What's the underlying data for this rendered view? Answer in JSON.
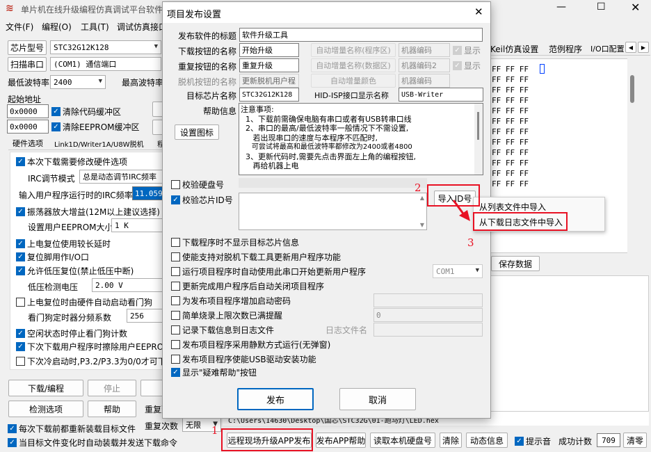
{
  "main": {
    "title": "单片机在线升级编程仿真调试平台软件",
    "menu": [
      "文件(F)",
      "编程(O)",
      "工具(T)",
      "调试仿真接口"
    ],
    "chip_label": "芯片型号",
    "chip_value": "STC32G12K128",
    "scan_label": "扫描串口",
    "port_value": "(COM1) 通信端口",
    "min_baud_label": "最低波特率",
    "min_baud_value": "2400",
    "max_baud_label": "最高波特率",
    "start_addr_label": "起始地址",
    "addr1": "0x0000",
    "clear_code": "清除代码缓冲区",
    "addr2": "0x0000",
    "clear_eeprom": "清除EEPROM缓冲区",
    "tabs": [
      "硬件选项",
      "Link1D/Writer1A/U8W脱机",
      "程"
    ],
    "opt_modify": "本次下载需要修改硬件选项",
    "irc_mode_label": "IRC调节模式",
    "irc_mode_value": "总是动态调节IRC频率",
    "irc_freq_label": "输入用户程序运行时的IRC频率",
    "irc_freq_value": "11.0592",
    "opt_osc": "振荡器放大增益(12M以上建议选择)",
    "eeprom_label": "设置用户EEPROM大小",
    "eeprom_value": "1  K",
    "opt_reset_delay": "上电复位使用较长延时",
    "opt_reset_io": "复位脚用作I/O口",
    "opt_lvr": "允许低压复位(禁止低压中断)",
    "lvd_label": "低压检测电压",
    "lvd_value": "2.00 V",
    "opt_wdt": "上电复位时由硬件自动启动看门狗",
    "wdt_label": "看门狗定时器分频系数",
    "wdt_value": "256",
    "opt_idle_wdt": "空闲状态时停止看门狗计数",
    "opt_erase": "下次下载用户程序时擦除用户EEPROM",
    "opt_p32": "下次冷启动时,P3.2/P3.3为0/0才可下",
    "btn_download": "下载/编程",
    "btn_stop": "停止",
    "btn_check": "检测选项",
    "btn_help": "帮助",
    "repeat_delay": "重复延",
    "repeat_count_label": "重复次数",
    "repeat_count_value": "无限",
    "opt_reload": "每次下载前都重新装载目标文件",
    "opt_autosend": "当目标文件变化时自动装载并发送下载命令",
    "right_tabs": [
      "Keil仿真设置",
      "范例程序",
      "I/O口配置"
    ],
    "hex_rows": [
      "FF FF FF",
      "FF FF FF",
      "FF FF FF",
      "FF FF FF",
      "FF FF FF",
      "FF FF FF",
      "FF FF FF",
      "FF FF FF",
      "FF FF FF",
      "FF FF FF",
      "FF FF FF",
      "FF FF FF"
    ],
    "save_data": "保存数据",
    "file_path": "C:\\Users\\14630\\Desktop\\国芯\\STC32G\\01-跑马灯\\LED.hex",
    "bottom_buttons": [
      "远程现场升级APP发布",
      "发布APP帮助",
      "读取本机硬盘号",
      "清除",
      "动态信息"
    ],
    "beep": "提示音",
    "success_label": "成功计数",
    "success_value": "709",
    "clear_count": "清零"
  },
  "dialog": {
    "title": "项目发布设置",
    "title_label": "发布软件的标题",
    "title_value": "软件升级工具",
    "download_btn_label": "下载按钮的名称",
    "download_btn_value": "开始升级",
    "inc_prog_label": "自动增量名称(程序区)",
    "machine_code1": "机器编码",
    "show1": "显示",
    "repeat_btn_label": "重复按钮的名称",
    "repeat_btn_value": "重复升级",
    "inc_data_label": "自动增量名称(数据区)",
    "machine_code2": "机器编码2",
    "show2": "显示",
    "offline_btn_label": "脱机按钮的名称",
    "offline_btn_value": "更新脱机用户程",
    "inc_color": "自动增量颜色",
    "machine_code3": "机器编码",
    "target_chip_label": "目标芯片名称",
    "target_chip_value": "STC32G12K128",
    "hid_label": "HID-ISP接口显示名称",
    "hid_value": "USB-Writer",
    "help_label": "帮助信息",
    "help_lines": [
      "注意事项:",
      "  1、下载前需确保电脑有串口或者有USB转串口线",
      "  2、串口的最高/最低波特率一般情况下不需设置,",
      "     若出现串口的速度与本程序不匹配时,",
      "     可尝试将最高和最低波特率都修改为2400或者4800",
      "  3、更新代码时,需要先点击界面左上角的编程按钮,",
      "     再给机器上电"
    ],
    "set_icon": "设置图标",
    "check_disk": "校验硬盘号",
    "check_chip": "校验芯片ID号",
    "import_id": "导入ID号",
    "menu_items": [
      "从列表文件中导入",
      "从下载日志文件中导入"
    ],
    "options": [
      "下载程序时不显示目标芯片信息",
      "使能支持对脱机下载工具更新用户程序功能",
      "运行项目程序时自动使用此串口开始更新用户程序",
      "更新完成用户程序后自动关闭项目程序",
      "为发布项目程序增加启动密码",
      "简单烧录上限次数已满提醒",
      "记录下载信息到日志文件",
      "发布项目程序采用静默方式运行(无弹窗)",
      "发布项目程序使能USB驱动安装功能",
      "显示\"疑难帮助\"按钮"
    ],
    "com_value": "COM1",
    "limit_value": "0",
    "log_name_label": "日志文件名",
    "publish": "发布",
    "cancel": "取消"
  },
  "annotations": {
    "n1": "1",
    "n2": "2",
    "n3": "3"
  },
  "colors": {
    "accent": "#0067c0",
    "highlight": "#e81123"
  }
}
